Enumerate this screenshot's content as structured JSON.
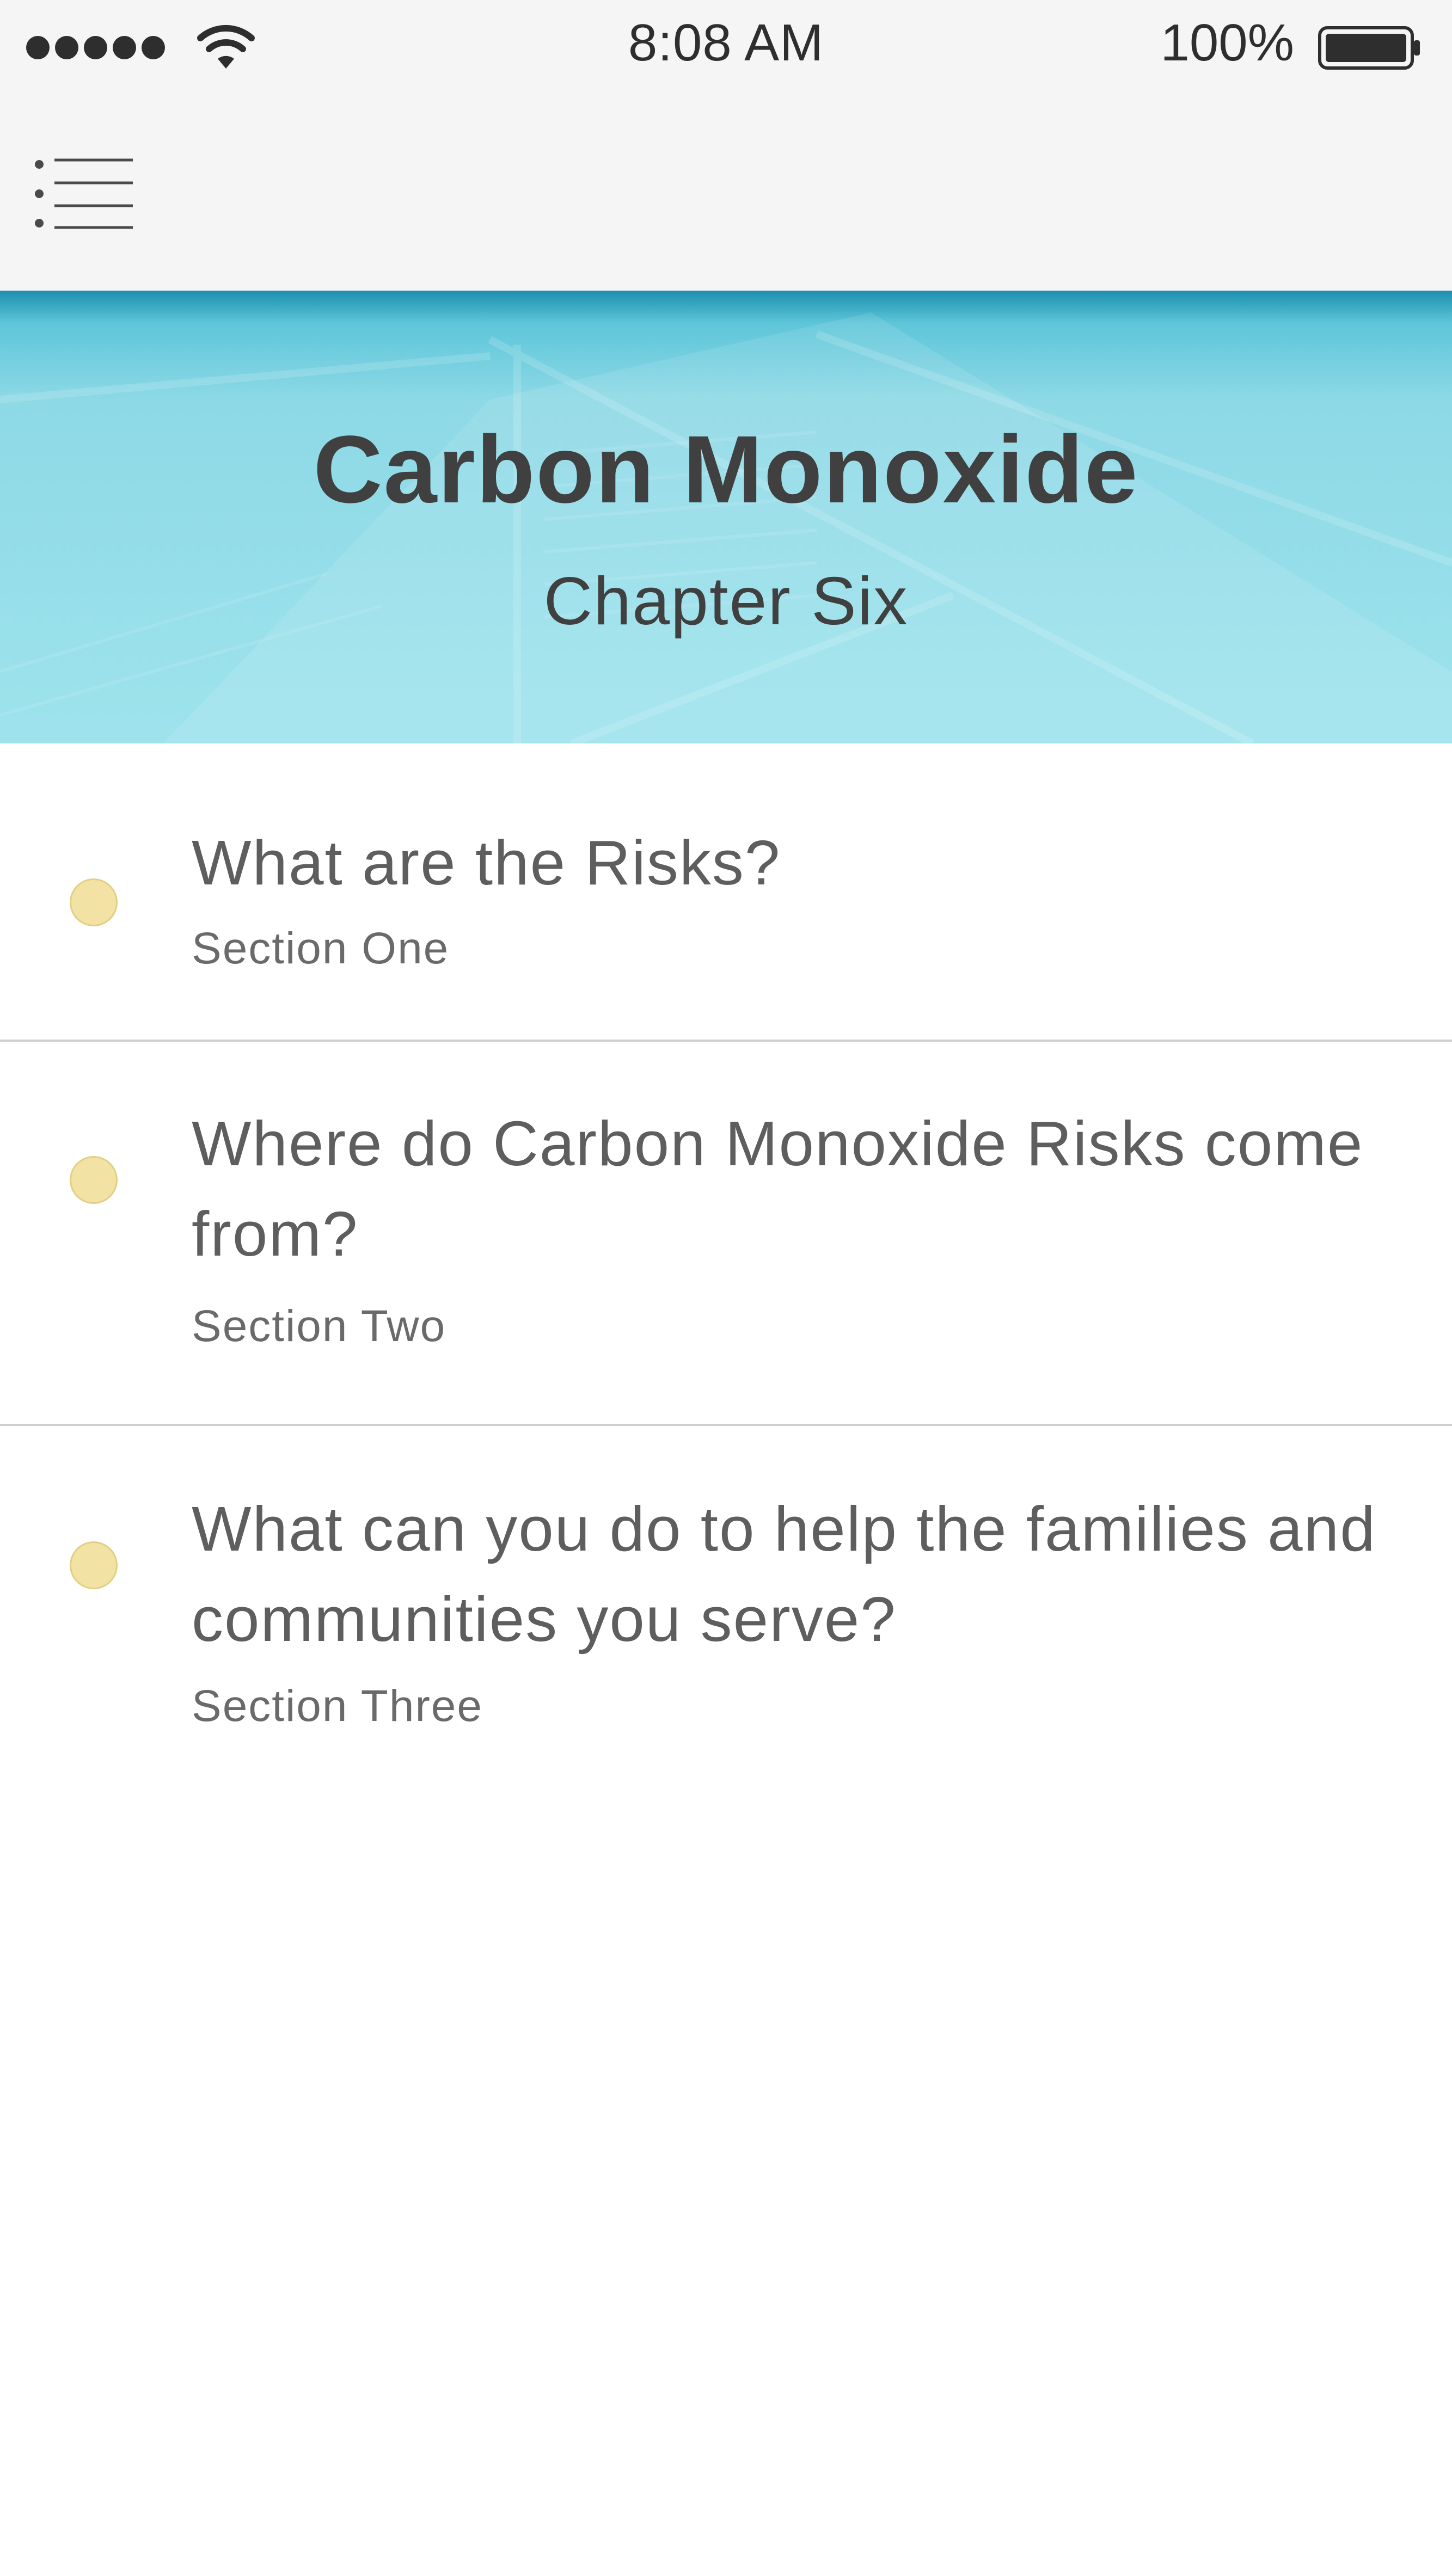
{
  "status_bar": {
    "time": "8:08 AM",
    "battery_percent": "100%",
    "signal_bars": 5,
    "icons": [
      "signal-dots-icon",
      "wifi-icon",
      "battery-icon"
    ]
  },
  "nav": {
    "menu_icon": "menu-list-icon"
  },
  "hero": {
    "title": "Carbon Monoxide",
    "subtitle": "Chapter Six",
    "accent_color": "#9ee3ec"
  },
  "sections": [
    {
      "title": "What are the Risks?",
      "subtitle": "Section One"
    },
    {
      "title": "Where do Carbon Monoxide Risks come from?",
      "subtitle": "Section Two"
    },
    {
      "title": "What can you do to help the families and communities you serve?",
      "subtitle": "Section Three"
    }
  ],
  "colors": {
    "status_dot": "#f2e2a3",
    "text": "#5e5e5e",
    "title": "#404040"
  }
}
